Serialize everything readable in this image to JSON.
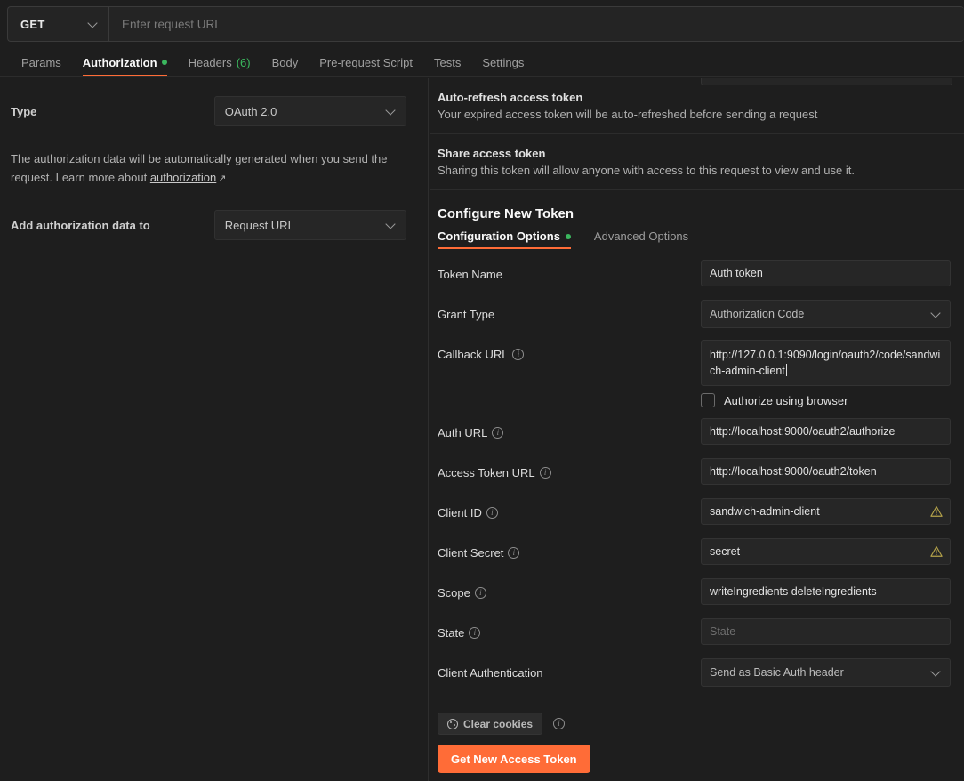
{
  "request_bar": {
    "method": "GET",
    "url_value": "",
    "url_placeholder": "Enter request URL",
    "method_chevron_icon": "chevron-down-icon"
  },
  "tabs": [
    {
      "label": "Params",
      "active": false,
      "dot": false,
      "count": ""
    },
    {
      "label": "Authorization",
      "active": true,
      "dot": true,
      "count": ""
    },
    {
      "label": "Headers",
      "active": false,
      "dot": false,
      "count": "(6)"
    },
    {
      "label": "Body",
      "active": false,
      "dot": false,
      "count": ""
    },
    {
      "label": "Pre-request Script",
      "active": false,
      "dot": false,
      "count": ""
    },
    {
      "label": "Tests",
      "active": false,
      "dot": false,
      "count": ""
    },
    {
      "label": "Settings",
      "active": false,
      "dot": false,
      "count": ""
    }
  ],
  "left_panel": {
    "type_label": "Type",
    "type_value": "OAuth 2.0",
    "help_text_before": "The authorization data will be automatically generated when you send the request. Learn more about ",
    "help_link": "authorization",
    "help_link_arrow": "↗",
    "add_data_label": "Add authorization data to",
    "add_data_value": "Request URL"
  },
  "right_panel": {
    "auto_refresh": {
      "title": "Auto-refresh access token",
      "desc": "Your expired access token will be auto-refreshed before sending a request"
    },
    "share_token": {
      "title": "Share access token",
      "desc": "Sharing this token will allow anyone with access to this request to view and use it."
    },
    "configure": {
      "title": "Configure New Token",
      "subtabs": [
        {
          "label": "Configuration Options",
          "active": true,
          "dot": true
        },
        {
          "label": "Advanced Options",
          "active": false,
          "dot": false
        }
      ]
    },
    "fields": [
      {
        "label": "Token Name",
        "info": false,
        "kind": "text",
        "value": "Auth token",
        "placeholder": "",
        "warn": false
      },
      {
        "label": "Grant Type",
        "info": false,
        "kind": "select",
        "value": "Authorization Code",
        "placeholder": "",
        "warn": false
      },
      {
        "label": "Callback URL",
        "info": true,
        "kind": "textarea",
        "value": "http://127.0.0.1:9090/login/oauth2/code/sandwich-admin-client",
        "placeholder": "",
        "warn": false
      },
      {
        "label": "Auth URL",
        "info": true,
        "kind": "text",
        "value": "http://localhost:9000/oauth2/authorize",
        "placeholder": "",
        "warn": false
      },
      {
        "label": "Access Token URL",
        "info": true,
        "kind": "text",
        "value": "http://localhost:9000/oauth2/token",
        "placeholder": "",
        "warn": false
      },
      {
        "label": "Client ID",
        "info": true,
        "kind": "text",
        "value": "sandwich-admin-client",
        "placeholder": "",
        "warn": true
      },
      {
        "label": "Client Secret",
        "info": true,
        "kind": "text",
        "value": "secret",
        "placeholder": "",
        "warn": true
      },
      {
        "label": "Scope",
        "info": true,
        "kind": "text",
        "value": "writeIngredients deleteIngredients",
        "placeholder": "",
        "warn": false
      },
      {
        "label": "State",
        "info": true,
        "kind": "text",
        "value": "",
        "placeholder": "State",
        "warn": false
      },
      {
        "label": "Client Authentication",
        "info": false,
        "kind": "select",
        "value": "Send as Basic Auth header",
        "placeholder": "",
        "warn": false
      }
    ],
    "authorize_browser_label": "Authorize using browser",
    "clear_cookies_label": "Clear cookies",
    "get_token_label": "Get New Access Token"
  },
  "colors": {
    "accent_orange": "#ff6c37",
    "dot_green": "#3bb75e",
    "warn_amber": "#b5a34a",
    "background": "#1e1e1e",
    "field_bg": "#262626"
  }
}
